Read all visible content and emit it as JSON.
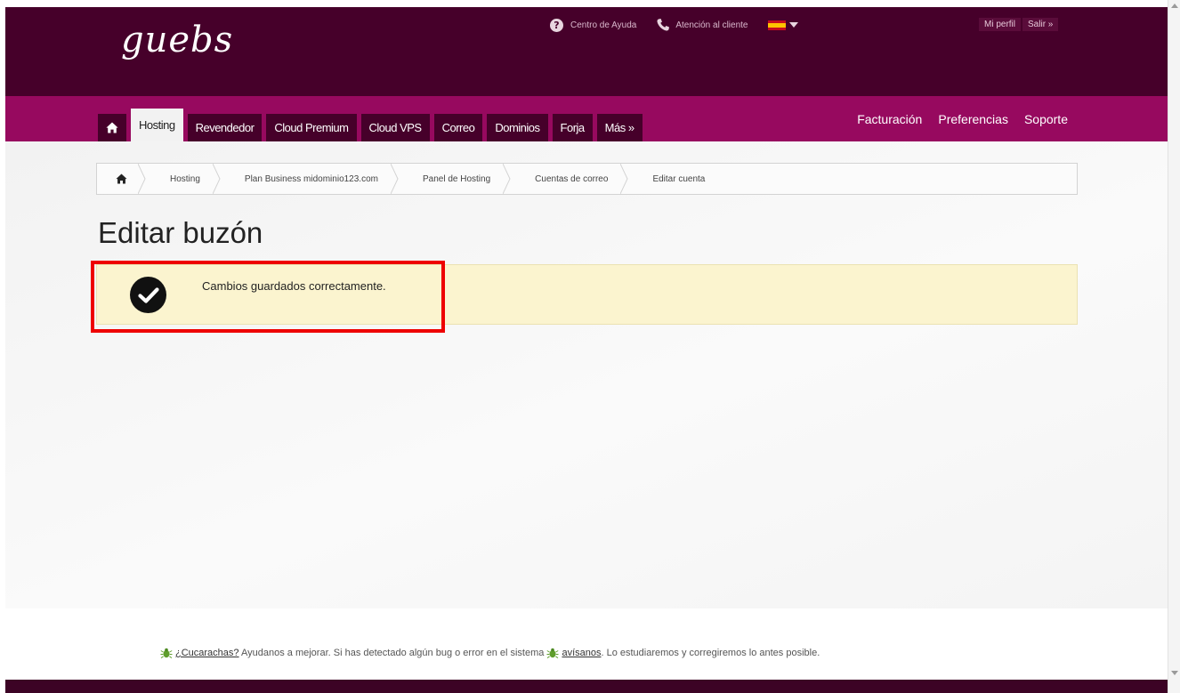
{
  "header": {
    "logo": "guebs",
    "help_label": "Centro de Ayuda",
    "support_label": "Atención al cliente",
    "language": "es",
    "profile_label": "Mi perfil",
    "logout_label": "Salir »"
  },
  "nav": {
    "tabs": [
      {
        "label": "Hosting",
        "active": true
      },
      {
        "label": "Revendedor"
      },
      {
        "label": "Cloud Premium"
      },
      {
        "label": "Cloud VPS"
      },
      {
        "label": "Correo"
      },
      {
        "label": "Dominios"
      },
      {
        "label": "Forja"
      },
      {
        "label": "Más »"
      }
    ],
    "right": [
      "Facturación",
      "Preferencias",
      "Soporte"
    ]
  },
  "breadcrumb": [
    "Hosting",
    "Plan Business midominio123.com",
    "Panel de Hosting",
    "Cuentas de correo",
    "Editar cuenta"
  ],
  "page": {
    "title": "Editar buzón",
    "alert_message": "Cambios guardados correctamente."
  },
  "footer": {
    "bug_link": "¿Cucarachas?",
    "bug_text": " Ayudanos a mejorar. Si has detectado algún bug o error en el sistema ",
    "notify_link": "avísanos",
    "bug_text_end": ". Lo estudiaremos y corregiremos lo antes posible."
  },
  "colors": {
    "header_bg": "#46002a",
    "nav_bg": "#97095f",
    "alert_bg": "#fbf4cf",
    "highlight": "#ee0000"
  }
}
